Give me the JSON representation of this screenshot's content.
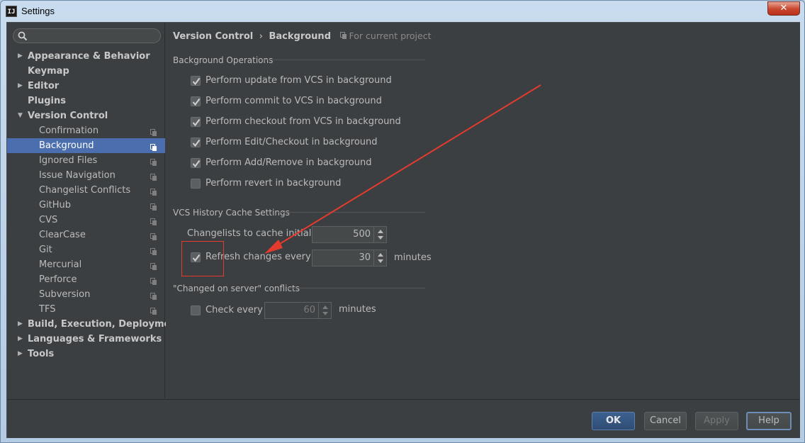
{
  "window": {
    "title": "Settings",
    "app_icon_text": "IJ",
    "close_label": "✕"
  },
  "search": {
    "placeholder": ""
  },
  "sidebar": {
    "items": [
      {
        "label": "Appearance & Behavior",
        "level": 0,
        "arrow": "▶"
      },
      {
        "label": "Keymap",
        "level": 0,
        "arrow": ""
      },
      {
        "label": "Editor",
        "level": 0,
        "arrow": "▶"
      },
      {
        "label": "Plugins",
        "level": 0,
        "arrow": ""
      },
      {
        "label": "Version Control",
        "level": 0,
        "arrow": "▼"
      },
      {
        "label": "Confirmation",
        "level": 1
      },
      {
        "label": "Background",
        "level": 1,
        "selected": true
      },
      {
        "label": "Ignored Files",
        "level": 1
      },
      {
        "label": "Issue Navigation",
        "level": 1
      },
      {
        "label": "Changelist Conflicts",
        "level": 1
      },
      {
        "label": "GitHub",
        "level": 1
      },
      {
        "label": "CVS",
        "level": 1
      },
      {
        "label": "ClearCase",
        "level": 1
      },
      {
        "label": "Git",
        "level": 1
      },
      {
        "label": "Mercurial",
        "level": 1
      },
      {
        "label": "Perforce",
        "level": 1
      },
      {
        "label": "Subversion",
        "level": 1
      },
      {
        "label": "TFS",
        "level": 1
      },
      {
        "label": "Build, Execution, Deployment",
        "level": 0,
        "arrow": "▶"
      },
      {
        "label": "Languages & Frameworks",
        "level": 0,
        "arrow": "▶"
      },
      {
        "label": "Tools",
        "level": 0,
        "arrow": "▶"
      }
    ]
  },
  "breadcrumb": {
    "parent": "Version Control",
    "separator": "›",
    "current": "Background",
    "scope": "For current project"
  },
  "background_operations": {
    "title": "Background Operations",
    "options": [
      {
        "label": "Perform update from VCS in background",
        "checked": true
      },
      {
        "label": "Perform commit to VCS in background",
        "checked": true
      },
      {
        "label": "Perform checkout from VCS in background",
        "checked": true
      },
      {
        "label": "Perform Edit/Checkout in background",
        "checked": true
      },
      {
        "label": "Perform Add/Remove in background",
        "checked": true
      },
      {
        "label": "Perform revert in background",
        "checked": false
      }
    ]
  },
  "history_cache": {
    "title": "VCS History Cache Settings",
    "changelists_label": "Changelists to cache initially:",
    "changelists_value": "500",
    "refresh_label": "Refresh changes every",
    "refresh_checked": true,
    "refresh_value": "30",
    "refresh_unit": "minutes"
  },
  "server_conflicts": {
    "title": "\"Changed on server\" conflicts",
    "check_label": "Check every",
    "check_checked": false,
    "check_value": "60",
    "check_unit": "minutes"
  },
  "buttons": {
    "ok": "OK",
    "cancel": "Cancel",
    "apply": "Apply",
    "help": "Help"
  },
  "colors": {
    "panel": "#3c3f41",
    "selection": "#4b6eaf",
    "annotation": "#e33b2e"
  }
}
